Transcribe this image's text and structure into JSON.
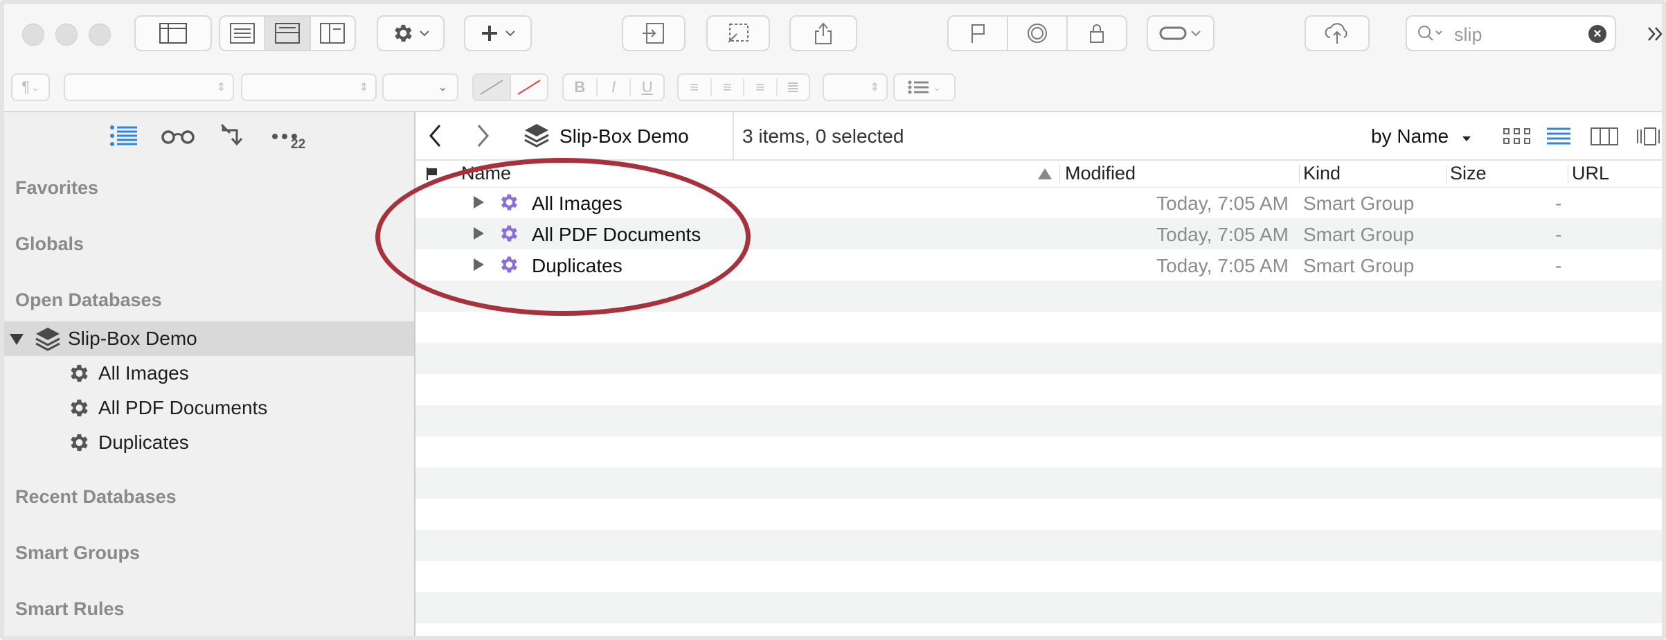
{
  "toolbar": {
    "search_value": "slip",
    "icons": [
      "sidebar-icon",
      "view-list-icon",
      "view-split-icon",
      "view-columns-icon",
      "gear-icon",
      "plus-icon",
      "move-into-icon",
      "select-icon",
      "share-icon",
      "flag-icon",
      "target-icon",
      "lock-icon",
      "tag-icon",
      "cloud-sync-icon",
      "search-icon",
      "clear-icon",
      "overflow-icon"
    ]
  },
  "format_bar": {
    "paragraph_glyph": "¶",
    "bold": "B",
    "italic": "I",
    "underline": "U"
  },
  "sidebar": {
    "tab_badge": "22",
    "sections": {
      "favorites": "Favorites",
      "globals": "Globals",
      "open_databases": "Open Databases",
      "recent_databases": "Recent Databases",
      "smart_groups": "Smart Groups",
      "smart_rules": "Smart Rules"
    },
    "database": {
      "name": "Slip-Box Demo"
    },
    "children": [
      {
        "label": "All Images"
      },
      {
        "label": "All PDF Documents"
      },
      {
        "label": "Duplicates"
      }
    ]
  },
  "pathbar": {
    "crumb": "Slip-Box Demo",
    "status": "3 items, 0 selected",
    "sort": "by Name"
  },
  "columns": {
    "name": "Name",
    "modified": "Modified",
    "kind": "Kind",
    "size": "Size",
    "url": "URL"
  },
  "rows": [
    {
      "name": "All Images",
      "modified": "Today, 7:05 AM",
      "kind": "Smart Group",
      "url": "-"
    },
    {
      "name": "All PDF Documents",
      "modified": "Today, 7:05 AM",
      "kind": "Smart Group",
      "url": "-"
    },
    {
      "name": "Duplicates",
      "modified": "Today, 7:05 AM",
      "kind": "Smart Group",
      "url": "-"
    }
  ],
  "colors": {
    "accent_blue": "#2f86e0",
    "smart_group_purple": "#8b6fd8",
    "annotation_red": "#a8323c",
    "sidebar_bg": "#f0f0f0",
    "selected_row": "#d9d9d9"
  }
}
